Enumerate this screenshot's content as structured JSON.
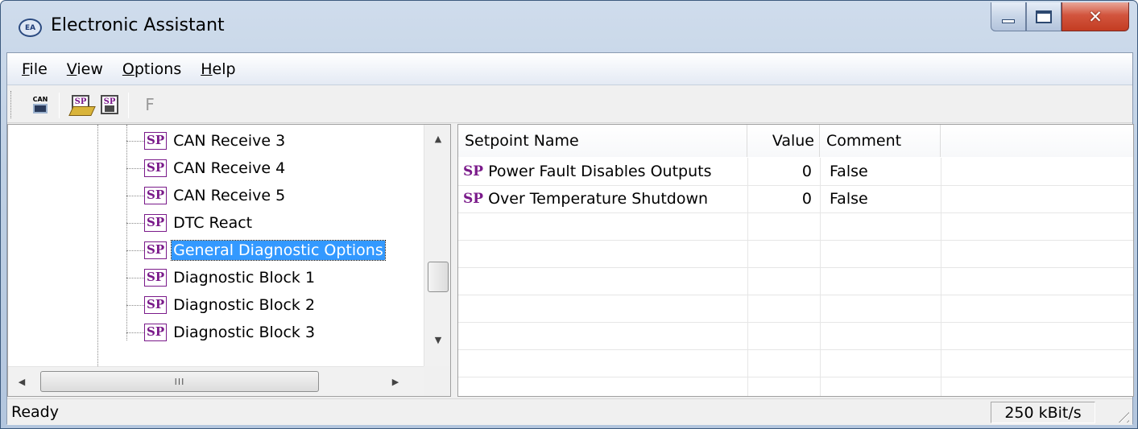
{
  "window": {
    "title": "Electronic Assistant",
    "icon_text": "EA"
  },
  "menu": [
    {
      "id": "file",
      "letter": "F",
      "rest": "ile"
    },
    {
      "id": "view",
      "letter": "V",
      "rest": "iew"
    },
    {
      "id": "options",
      "letter": "O",
      "rest": "ptions"
    },
    {
      "id": "help",
      "letter": "H",
      "rest": "elp"
    }
  ],
  "toolbar": {
    "can_label": "CAN",
    "sp_label": "SP",
    "f_label": "F"
  },
  "tree": {
    "badge": "SP",
    "items": [
      "CAN Receive 3",
      "CAN Receive 4",
      "CAN Receive 5",
      "DTC React",
      "General Diagnostic Options",
      "Diagnostic Block 1",
      "Diagnostic Block 2",
      "Diagnostic Block 3"
    ],
    "selected_index": 4,
    "hscroll_grip": "III"
  },
  "list": {
    "columns": [
      "Setpoint Name",
      "Value",
      "Comment"
    ],
    "row_marker": "SP",
    "rows": [
      {
        "name": "Power Fault Disables Outputs",
        "value": "0",
        "comment": "False"
      },
      {
        "name": "Over Temperature Shutdown",
        "value": "0",
        "comment": "False"
      }
    ]
  },
  "status": {
    "text": "Ready",
    "baud": "250 kBit/s"
  }
}
